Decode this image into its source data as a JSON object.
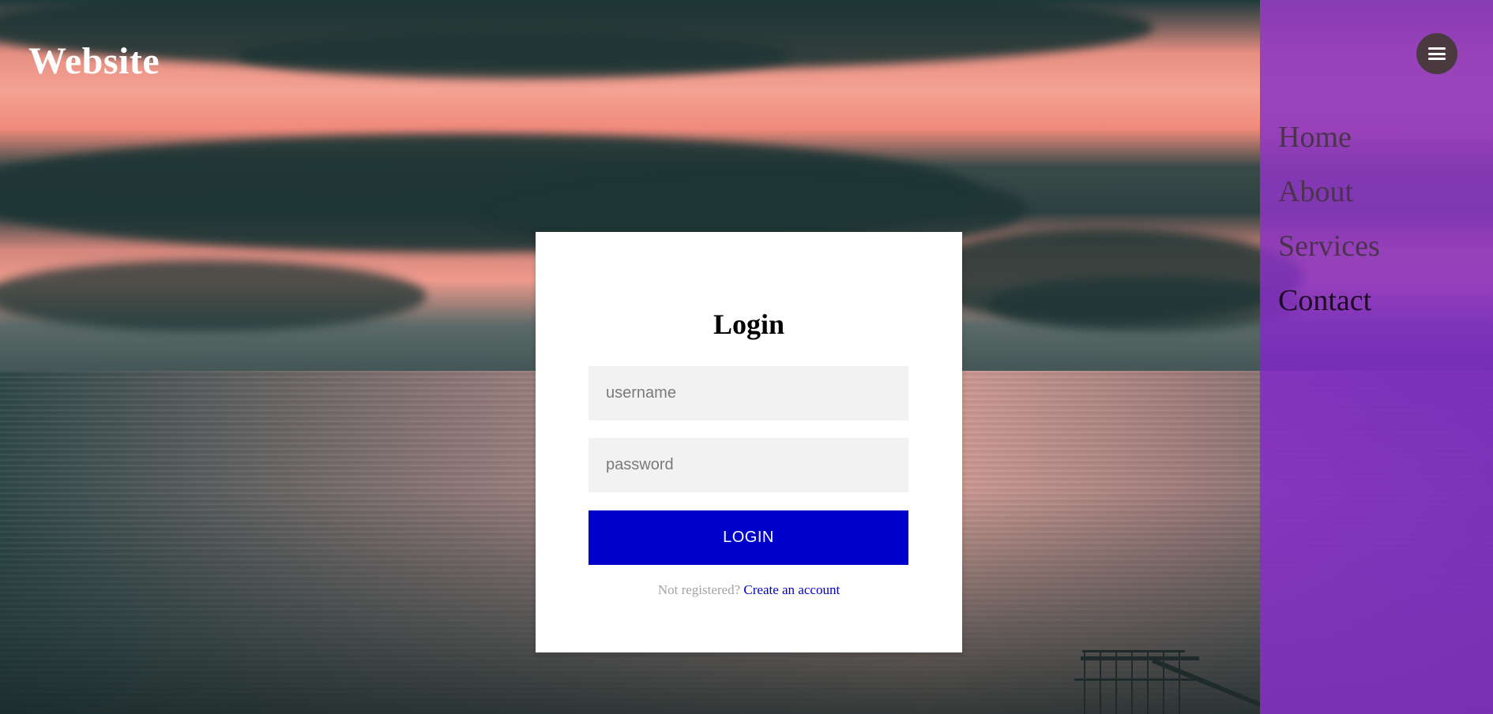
{
  "header": {
    "brand": "Website"
  },
  "nav": {
    "toggle_icon": "hamburger-menu-icon",
    "items": [
      {
        "label": "Home",
        "active": false
      },
      {
        "label": "About",
        "active": false
      },
      {
        "label": "Services",
        "active": false
      },
      {
        "label": "Contact",
        "active": true
      }
    ],
    "panel_color": "#8a30c8"
  },
  "login": {
    "title": "Login",
    "username_placeholder": "username",
    "password_placeholder": "password",
    "username_value": "",
    "password_value": "",
    "submit_label": "LOGIN",
    "register_prompt": "Not registered?",
    "register_link": "Create an account",
    "button_color": "#0000cc"
  }
}
